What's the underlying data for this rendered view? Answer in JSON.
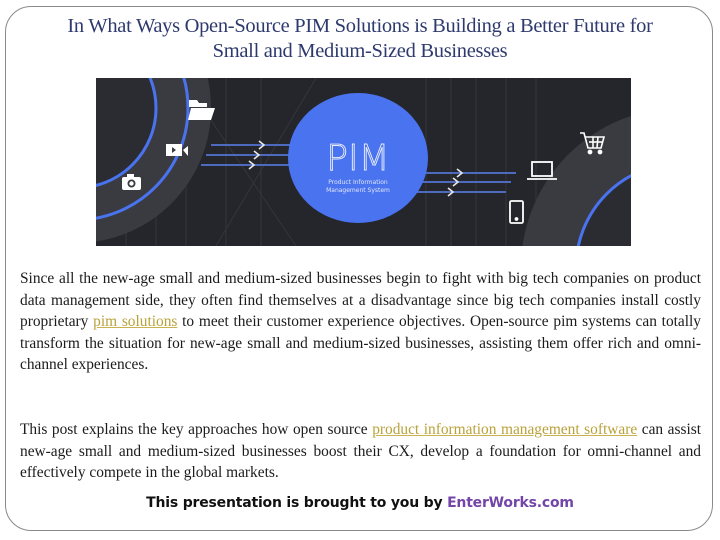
{
  "slide": {
    "title_line1": "In What Ways Open-Source PIM Solutions is Building a Better Future for",
    "title_line2": "Small and Medium-Sized Businesses",
    "hero": {
      "center_label": "PIM",
      "center_sub1": "Product Information",
      "center_sub2": "Management System",
      "left_icons": [
        "folder-icon",
        "video-camera-icon",
        "photo-camera-icon"
      ],
      "right_icons": [
        "shopping-cart-icon",
        "laptop-icon",
        "smartphone-icon"
      ],
      "colors": {
        "background": "#25262b",
        "ring": "#3a3b41",
        "accent": "#4a73ef"
      }
    },
    "paragraph1": {
      "before_link": "Since all the new-age small and medium-sized businesses begin to fight with big tech companies on product data management side, they often find themselves at a disadvantage since big tech companies install costly proprietary ",
      "link": "pim solutions",
      "after_link": " to meet their customer experience objectives. Open-source pim systems can totally transform the situation for new-age small and medium-sized businesses, assisting them offer rich and omni-channel experiences."
    },
    "paragraph2": {
      "before_link": "This post explains the key approaches how open source ",
      "link": "product information management software",
      "after_link": " can assist new-age small and medium-sized businesses boost their CX, develop a foundation for omni-channel and effectively compete in the global markets."
    },
    "footer": {
      "text": "This presentation is brought to you by ",
      "brand": "EnterWorks.com"
    },
    "colors": {
      "title": "#2e3a6e",
      "link": "#b9a23a",
      "brand": "#7445a8"
    }
  }
}
